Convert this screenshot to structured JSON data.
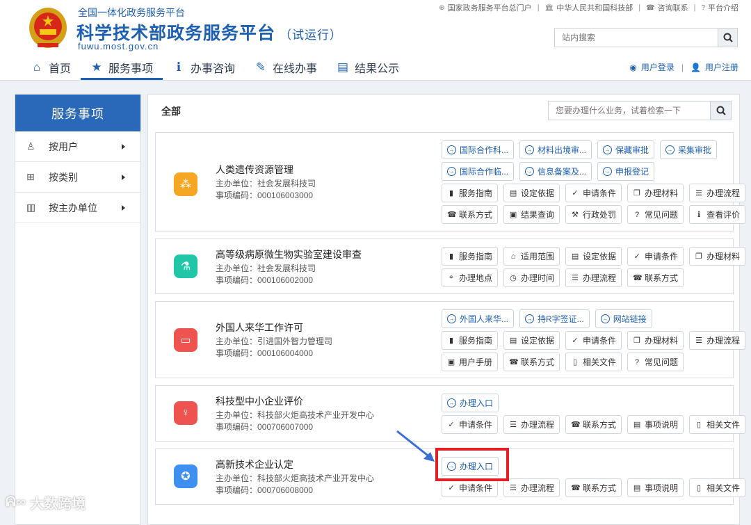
{
  "header": {
    "portal_subtitle": "全国一体化政务服务平台",
    "title": "科学技术部政务服务平台",
    "title_suffix": "（试运行）",
    "domain": "fuwu.most.gov.cn",
    "top_links": [
      {
        "label": "国家政务服务平台总门户",
        "icon": "globe-icon"
      },
      {
        "label": "中华人民共和国科技部",
        "icon": "bank-icon"
      },
      {
        "label": "咨询联系",
        "icon": "phone-icon"
      },
      {
        "label": "平台介绍",
        "icon": "question-icon"
      }
    ],
    "search_placeholder": "站内搜索",
    "nav": [
      {
        "label": "首页",
        "icon": "home-icon",
        "active": false
      },
      {
        "label": "服务事项",
        "icon": "star-icon",
        "active": true
      },
      {
        "label": "办事咨询",
        "icon": "info-icon",
        "active": false
      },
      {
        "label": "在线办事",
        "icon": "pencil-icon",
        "active": false
      },
      {
        "label": "结果公示",
        "icon": "book-icon",
        "active": false
      }
    ],
    "login_label": "用户登录",
    "register_label": "用户注册"
  },
  "sidebar": {
    "title": "服务事项",
    "items": [
      {
        "label": "按用户",
        "icon": "user-icon"
      },
      {
        "label": "按类别",
        "icon": "grid-icon"
      },
      {
        "label": "按主办单位",
        "icon": "building-icon"
      }
    ]
  },
  "main": {
    "title": "全部",
    "search_placeholder": "您要办理什么业务，试着检索一下",
    "unit_prefix": "主办单位：",
    "code_prefix": "事项编码：",
    "cards": [
      {
        "name": "人类遗传资源管理",
        "unit": "社会发展科技司",
        "code": "000106003000",
        "badge_color": "#f5a623",
        "badge_icon": "dna-icon",
        "rows": [
          [
            {
              "label": "国际合作科...",
              "icon": "arrow-circle-icon",
              "style": "blue"
            },
            {
              "label": "材料出境审...",
              "icon": "arrow-circle-icon",
              "style": "blue"
            },
            {
              "label": "保藏审批",
              "icon": "arrow-circle-icon",
              "style": "blue"
            },
            {
              "label": "采集审批",
              "icon": "arrow-circle-icon",
              "style": "blue"
            }
          ],
          [
            {
              "label": "国际合作临...",
              "icon": "arrow-circle-icon",
              "style": "blue"
            },
            {
              "label": "信息备案及...",
              "icon": "arrow-circle-icon",
              "style": "blue"
            },
            {
              "label": "申报登记",
              "icon": "arrow-circle-icon",
              "style": "blue"
            }
          ],
          [
            {
              "label": "服务指南",
              "icon": "book-icon",
              "style": "plain"
            },
            {
              "label": "设定依据",
              "icon": "document-icon",
              "style": "plain"
            },
            {
              "label": "申请条件",
              "icon": "check-icon",
              "style": "plain"
            },
            {
              "label": "办理材料",
              "icon": "copy-icon",
              "style": "plain"
            },
            {
              "label": "办理流程",
              "icon": "list-icon",
              "style": "plain"
            }
          ],
          [
            {
              "label": "联系方式",
              "icon": "phone-icon",
              "style": "plain"
            },
            {
              "label": "结果查询",
              "icon": "result-icon",
              "style": "plain"
            },
            {
              "label": "行政处罚",
              "icon": "gavel-icon",
              "style": "plain"
            },
            {
              "label": "常见问题",
              "icon": "question-icon",
              "style": "plain"
            },
            {
              "label": "查看评价",
              "icon": "info-icon",
              "style": "plain"
            }
          ]
        ]
      },
      {
        "name": "高等级病原微生物实验室建设审查",
        "unit": "社会发展科技司",
        "code": "000106002000",
        "badge_color": "#1fc7a8",
        "badge_icon": "flask-icon",
        "rows": [
          [
            {
              "label": "服务指南",
              "icon": "book-icon",
              "style": "plain"
            },
            {
              "label": "适用范围",
              "icon": "bank-icon",
              "style": "plain"
            },
            {
              "label": "设定依据",
              "icon": "document-icon",
              "style": "plain"
            },
            {
              "label": "申请条件",
              "icon": "check-icon",
              "style": "plain"
            },
            {
              "label": "办理材料",
              "icon": "copy-icon",
              "style": "plain"
            }
          ],
          [
            {
              "label": "办理地点",
              "icon": "map-icon",
              "style": "plain"
            },
            {
              "label": "办理时间",
              "icon": "clock-icon",
              "style": "plain"
            },
            {
              "label": "办理流程",
              "icon": "list-icon",
              "style": "plain"
            },
            {
              "label": "联系方式",
              "icon": "phone-icon",
              "style": "plain"
            }
          ]
        ]
      },
      {
        "name": "外国人来华工作许可",
        "unit": "引进国外智力管理司",
        "code": "000106004000",
        "badge_color": "#ef5350",
        "badge_icon": "monitor-icon",
        "rows": [
          [
            {
              "label": "外国人来华...",
              "icon": "arrow-circle-icon",
              "style": "blue"
            },
            {
              "label": "持R字签证...",
              "icon": "arrow-circle-icon",
              "style": "blue"
            },
            {
              "label": "网站链接",
              "icon": "arrow-circle-icon",
              "style": "blue"
            }
          ],
          [
            {
              "label": "服务指南",
              "icon": "book-icon",
              "style": "plain"
            },
            {
              "label": "设定依据",
              "icon": "document-icon",
              "style": "plain"
            },
            {
              "label": "申请条件",
              "icon": "check-icon",
              "style": "plain"
            },
            {
              "label": "办理材料",
              "icon": "copy-icon",
              "style": "plain"
            },
            {
              "label": "办理流程",
              "icon": "list-icon",
              "style": "plain"
            }
          ],
          [
            {
              "label": "用户手册",
              "icon": "manual-icon",
              "style": "plain"
            },
            {
              "label": "联系方式",
              "icon": "phone-icon",
              "style": "plain"
            },
            {
              "label": "相关文件",
              "icon": "file-icon",
              "style": "plain"
            },
            {
              "label": "常见问题",
              "icon": "question-icon",
              "style": "plain"
            }
          ]
        ]
      },
      {
        "name": "科技型中小企业评价",
        "unit": "科技部火炬高技术产业开发中心",
        "code": "000706007000",
        "badge_color": "#ef5350",
        "badge_icon": "person-icon",
        "rows": [
          [
            {
              "label": "办理入口",
              "icon": "arrow-circle-icon",
              "style": "blue"
            }
          ],
          [
            {
              "label": "申请条件",
              "icon": "check-icon",
              "style": "plain"
            },
            {
              "label": "办理流程",
              "icon": "list-icon",
              "style": "plain"
            },
            {
              "label": "联系方式",
              "icon": "phone-icon",
              "style": "plain"
            },
            {
              "label": "事项说明",
              "icon": "document-icon",
              "style": "plain"
            },
            {
              "label": "相关文件",
              "icon": "file-icon",
              "style": "plain"
            }
          ]
        ]
      },
      {
        "name": "高新技术企业认定",
        "unit": "科技部火炬高技术产业开发中心",
        "code": "000706008000",
        "badge_color": "#3d8ff0",
        "badge_icon": "award-icon",
        "rows": [
          [
            {
              "label": "办理入口",
              "icon": "arrow-circle-icon",
              "style": "blue"
            }
          ],
          [
            {
              "label": "申请条件",
              "icon": "check-icon",
              "style": "plain"
            },
            {
              "label": "办理流程",
              "icon": "list-icon",
              "style": "plain"
            },
            {
              "label": "联系方式",
              "icon": "phone-icon",
              "style": "plain"
            },
            {
              "label": "事项说明",
              "icon": "document-icon",
              "style": "plain"
            },
            {
              "label": "相关文件",
              "icon": "file-icon",
              "style": "plain"
            }
          ]
        ]
      }
    ]
  },
  "watermark": "大数跨境"
}
